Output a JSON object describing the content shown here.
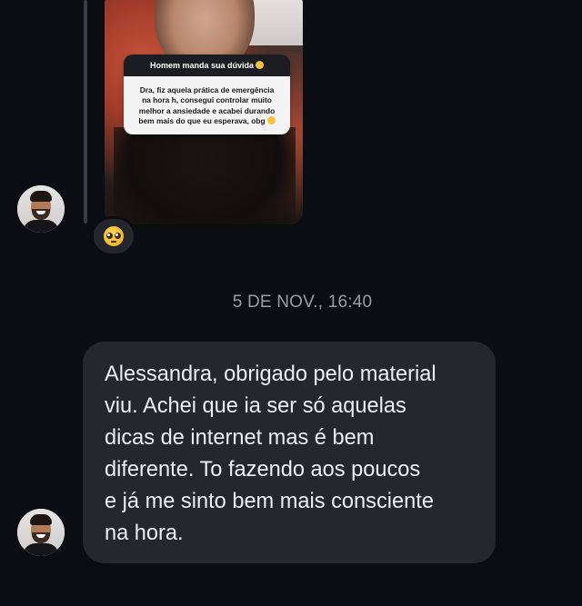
{
  "story_reply": {
    "question_header": "Homem manda sua dúvida",
    "question_body": "Dra, fiz aquela prática de emergência na hora h, consegui controlar muito melhor a ansiedade e acabei durando bem mais do que eu esperava, obg",
    "header_emoji_icon": "thinking-face-icon",
    "body_emoji_icon": "smiling-face-icon"
  },
  "reaction": {
    "emoji_icon": "pleading-face-icon"
  },
  "timestamp": "5 DE NOV., 16:40",
  "message": {
    "text": "Alessandra, obrigado pelo material\nviu. Achei que ia ser só aquelas\ndicas de internet mas é bem\ndiferente. To fazendo aos poucos\ne já me sinto bem mais consciente\nna hora."
  },
  "colors": {
    "background": "#0b0d13",
    "bubble": "#25272d",
    "bubble_text": "#eceef1",
    "timestamp": "#9a9ca3",
    "reply_line": "#3a3c44"
  }
}
